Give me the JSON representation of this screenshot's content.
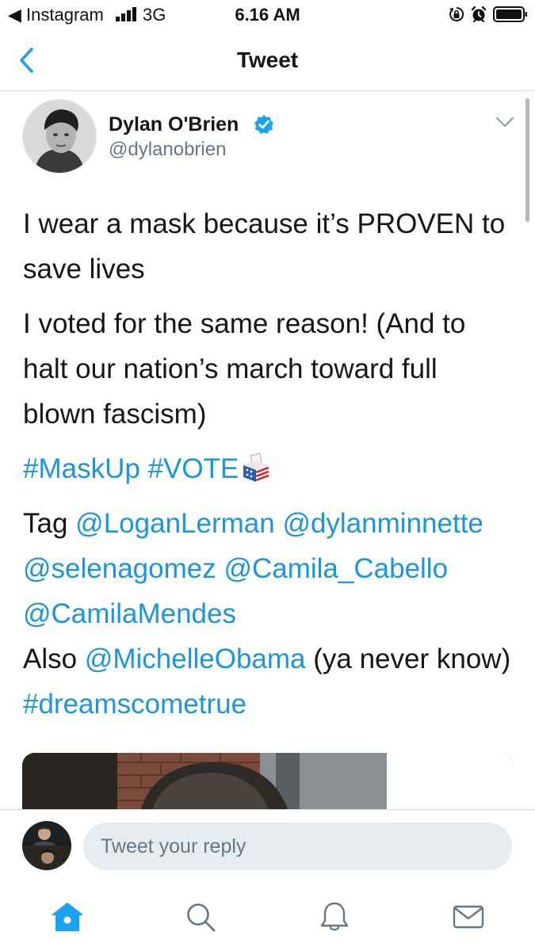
{
  "status_bar": {
    "back_app": "◀ Instagram",
    "network": "3G",
    "time": "6.16 AM"
  },
  "header": {
    "title": "Tweet"
  },
  "tweet": {
    "author_name": "Dylan O'Brien",
    "author_handle": "@dylanobrien",
    "paragraphs": {
      "p1": "I wear a mask because it’s PROVEN to save lives",
      "p2": "I voted for the same reason! (And to halt our nation’s march toward full blown fascism)",
      "hashtag_maskup": "#MaskUp",
      "hashtag_vote": "#VOTE",
      "tag_prefix": "Tag",
      "mention_loganlerman": "@LoganLerman",
      "mention_dylanminnette": "@dylanminnette",
      "mention_selenagomez": "@selenagomez",
      "mention_camila_cabello": "@Camila_Cabello",
      "mention_camilamendes": "@CamilaMendes",
      "also_prefix": "Also",
      "mention_michelleobama": "@MichelleObama",
      "ya_never_know": "(ya never know)",
      "hashtag_dreamscometrue": "#dreamscometrue"
    }
  },
  "reply": {
    "placeholder": "Tweet your reply"
  },
  "tab_bar": {
    "items": [
      "home",
      "search",
      "notifications",
      "messages"
    ],
    "active": "home"
  },
  "colors": {
    "link": "#1b95e0",
    "text": "#14171a",
    "secondary": "#657786",
    "verified": "#1da1f2",
    "input_bg": "#e6ecf0"
  },
  "icons": {
    "status": [
      "signal-bars-icon",
      "rotation-lock-icon",
      "alarm-icon",
      "battery-icon"
    ],
    "header": [
      "back-chevron-icon"
    ],
    "tweet": [
      "verified-badge-icon",
      "caret-down-icon",
      "ballot-box-icon"
    ],
    "tabs": [
      "home-icon",
      "search-icon",
      "bell-icon",
      "envelope-icon"
    ]
  }
}
